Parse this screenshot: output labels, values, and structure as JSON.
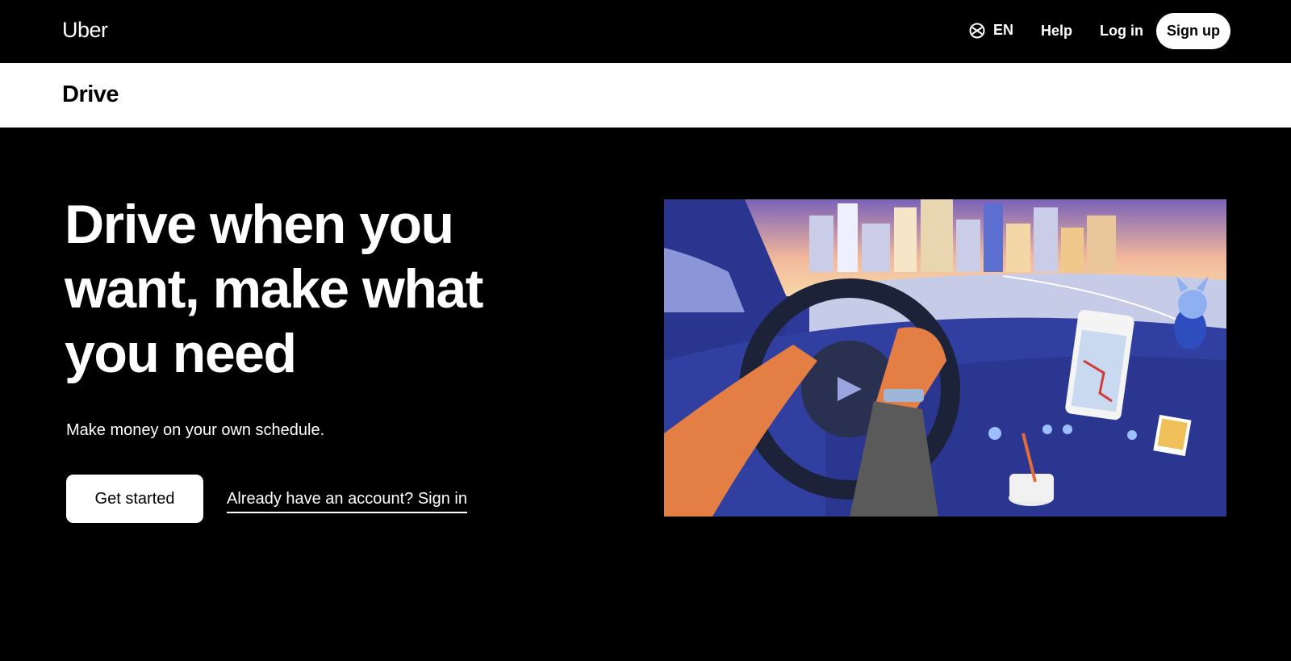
{
  "nav": {
    "logo": "Uber",
    "language": "EN",
    "help": "Help",
    "login": "Log in",
    "signup": "Sign up"
  },
  "subheader": {
    "title": "Drive"
  },
  "hero": {
    "title": "Drive when you want, make what you need",
    "subtitle": "Make money on your own schedule.",
    "cta": "Get started",
    "signin": "Already have an account? Sign in"
  },
  "icons": {
    "language": "globe-icon"
  },
  "colors": {
    "background": "#000000",
    "button": "#ffffff",
    "illustration_blue": "#3a4aa8"
  }
}
